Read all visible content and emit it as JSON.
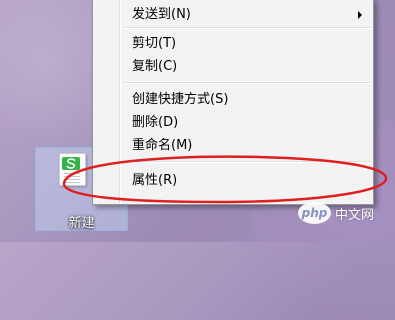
{
  "desktop": {
    "icon": {
      "label": "新建",
      "icon_name": "document-s-icon",
      "badge_color": "#35b34a",
      "selected": true
    }
  },
  "context_menu": {
    "items": [
      {
        "label": "发送到(N)",
        "has_submenu": true
      },
      {
        "label": "剪切(T)"
      },
      {
        "label": "复制(C)"
      },
      {
        "label": "创建快捷方式(S)"
      },
      {
        "label": "删除(D)"
      },
      {
        "label": "重命名(M)"
      },
      {
        "label": "属性(R)",
        "highlighted_by_annotation": true
      }
    ]
  },
  "annotation": {
    "color": "#e02020",
    "shape": "ellipse"
  },
  "watermark": {
    "logo_text": "php",
    "text": "中文网"
  }
}
